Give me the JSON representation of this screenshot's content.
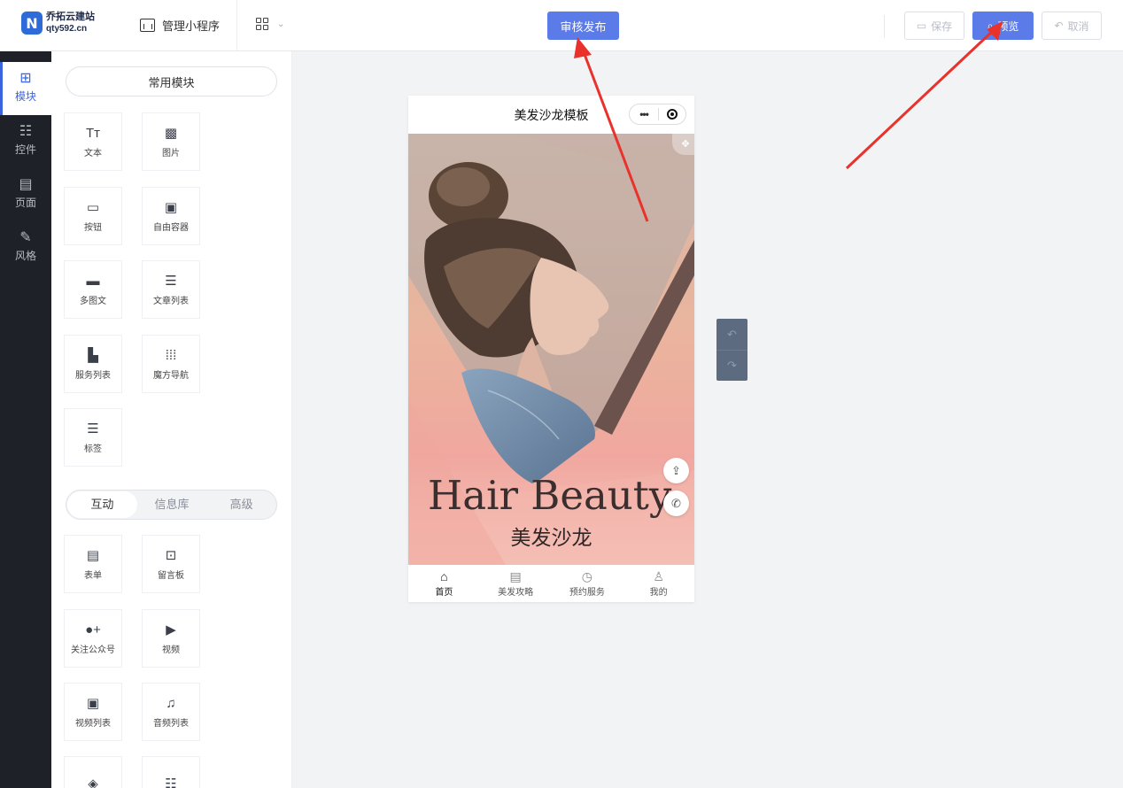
{
  "header": {
    "brand_mark": "N",
    "brand_name": "乔拓云建站",
    "brand_domain": "qty592.cn",
    "manage_label": "管理小程序",
    "apps_icon": "grid-icon",
    "publish_label": "审核发布",
    "save_label": "保存",
    "preview_label": "预览",
    "cancel_label": "取消"
  },
  "rail": {
    "items": [
      {
        "label": "模块",
        "icon": "plus-square-icon",
        "active": true
      },
      {
        "label": "控件",
        "icon": "sliders-icon"
      },
      {
        "label": "页面",
        "icon": "pages-icon"
      },
      {
        "label": "风格",
        "icon": "magic-wand-icon"
      }
    ]
  },
  "panel": {
    "common_title": "常用模块",
    "common_tiles": [
      {
        "label": "文本",
        "icon": "text-icon"
      },
      {
        "label": "图片",
        "icon": "image-icon"
      },
      {
        "label": "按钮",
        "icon": "button-icon"
      },
      {
        "label": "自由容器",
        "icon": "container-icon"
      },
      {
        "label": "多图文",
        "icon": "multi-image-icon"
      },
      {
        "label": "文章列表",
        "icon": "article-list-icon"
      },
      {
        "label": "服务列表",
        "icon": "service-list-icon"
      },
      {
        "label": "魔方导航",
        "icon": "cube-nav-icon"
      },
      {
        "label": "标签",
        "icon": "tag-icon"
      }
    ],
    "tabs": [
      "互动",
      "信息库",
      "高级"
    ],
    "active_tab": "互动",
    "interactive_tiles": [
      {
        "label": "表单",
        "icon": "form-icon"
      },
      {
        "label": "留言板",
        "icon": "message-board-icon"
      },
      {
        "label": "关注公众号",
        "icon": "follow-icon"
      },
      {
        "label": "视频",
        "icon": "video-icon"
      },
      {
        "label": "视频列表",
        "icon": "video-list-icon"
      },
      {
        "label": "音频列表",
        "icon": "audio-list-icon"
      },
      {
        "label": "",
        "icon": "coupon-icon"
      },
      {
        "label": "",
        "icon": "search-list-icon"
      }
    ]
  },
  "phone": {
    "title": "美发沙龙模板",
    "capsule_dots": "•••",
    "banner_heading": "Hair Beauty",
    "banner_subheading": "美发沙龙",
    "share_icon": "share-icon",
    "phone_icon": "phone-icon",
    "tabbar": [
      {
        "label": "首页",
        "icon": "home-icon",
        "active": true
      },
      {
        "label": "美发攻略",
        "icon": "document-icon"
      },
      {
        "label": "预约服务",
        "icon": "clock-icon"
      },
      {
        "label": "我的",
        "icon": "user-icon"
      }
    ]
  },
  "history": {
    "undo_icon": "undo-icon",
    "redo_icon": "redo-icon"
  },
  "colors": {
    "accent": "#5b7be8",
    "rail_bg": "#1f2128",
    "annotation_arrow": "#e8322b"
  }
}
